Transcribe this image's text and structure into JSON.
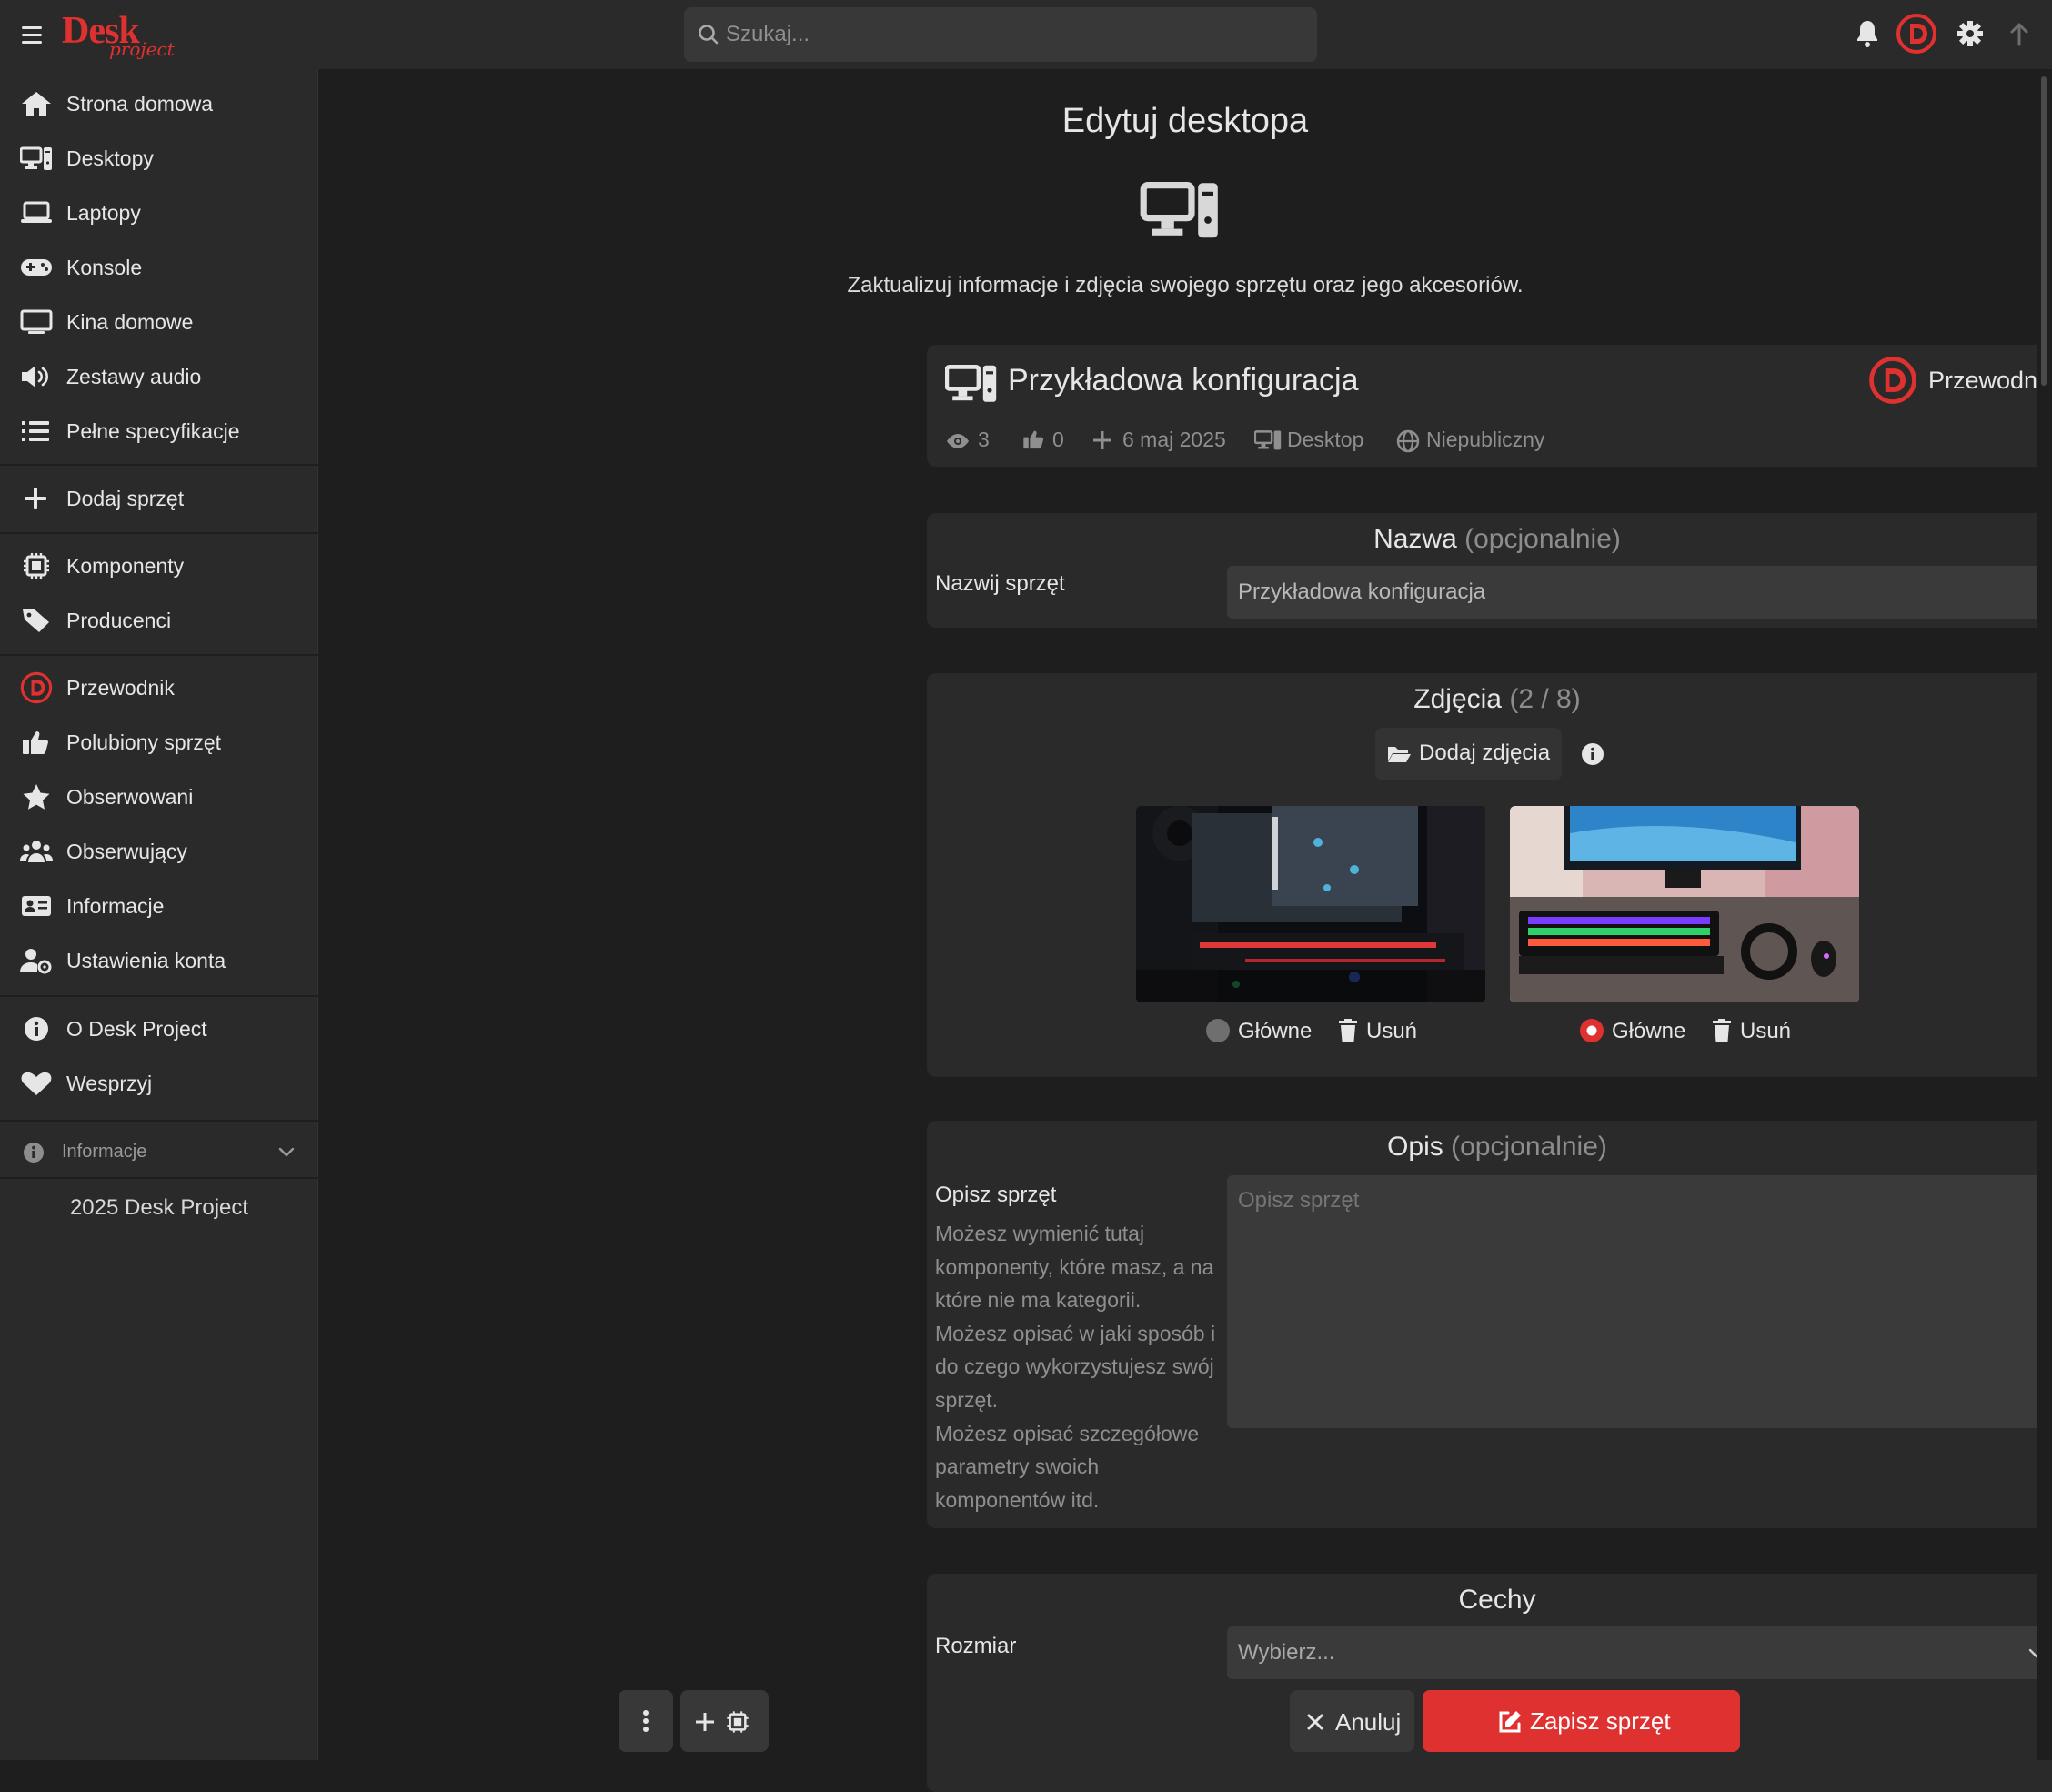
{
  "app": {
    "logo_main": "Desk",
    "logo_sub": "project"
  },
  "search": {
    "placeholder": "Szukaj..."
  },
  "colors": {
    "accent": "#e03131",
    "background": "#1e1e1e",
    "panel": "#2a2a2a",
    "input": "#3a3a3a"
  },
  "sidebar": {
    "items": [
      {
        "label": "Strona domowa",
        "icon": "home-icon"
      },
      {
        "label": "Desktopy",
        "icon": "desktop-icon"
      },
      {
        "label": "Laptopy",
        "icon": "laptop-icon"
      },
      {
        "label": "Konsole",
        "icon": "gamepad-icon"
      },
      {
        "label": "Kina domowe",
        "icon": "tv-icon"
      },
      {
        "label": "Zestawy audio",
        "icon": "speaker-icon"
      },
      {
        "label": "Pełne specyfikacje",
        "icon": "list-icon"
      },
      {
        "label": "Dodaj sprzęt",
        "icon": "plus-icon"
      },
      {
        "label": "Komponenty",
        "icon": "chip-icon"
      },
      {
        "label": "Producenci",
        "icon": "tag-icon"
      },
      {
        "label": "Przewodnik",
        "icon": "user-avatar-icon"
      },
      {
        "label": "Polubiony sprzęt",
        "icon": "thumbs-up-icon"
      },
      {
        "label": "Obserwowani",
        "icon": "star-icon"
      },
      {
        "label": "Obserwujący",
        "icon": "users-icon"
      },
      {
        "label": "Informacje",
        "icon": "id-card-icon"
      },
      {
        "label": "Ustawienia konta",
        "icon": "user-gear-icon"
      },
      {
        "label": "O Desk Project",
        "icon": "info-icon"
      },
      {
        "label": "Wesprzyj",
        "icon": "heart-icon"
      }
    ],
    "info_toggle": "Informacje",
    "footer": "2025 Desk Project"
  },
  "page": {
    "title": "Edytuj desktopa",
    "subtitle": "Zaktualizuj informacje i zdjęcia swojego sprzętu oraz jego akcesoriów."
  },
  "summary": {
    "name": "Przykładowa konfiguracja",
    "owner": "Przewodnik",
    "views": "3",
    "likes": "0",
    "date": "6 maj 2025",
    "type": "Desktop",
    "visibility": "Niepubliczny"
  },
  "name_section": {
    "title": "Nazwa",
    "optional": "(opcjonalnie)",
    "label": "Nazwij sprzęt",
    "value": "Przykładowa konfiguracja"
  },
  "photos": {
    "title": "Zdjęcia",
    "count": "(2 / 8)",
    "add_label": "Dodaj zdjęcia",
    "items": [
      {
        "main_label": "Główne",
        "delete_label": "Usuń",
        "is_main": false
      },
      {
        "main_label": "Główne",
        "delete_label": "Usuń",
        "is_main": true
      }
    ]
  },
  "description": {
    "title": "Opis",
    "optional": "(opcjonalnie)",
    "label": "Opisz sprzęt",
    "placeholder": "Opisz sprzęt",
    "help": [
      "Możesz wymienić tutaj komponenty, które masz, a na które nie ma kategorii.",
      "Możesz opisać w jaki sposób i do czego wykorzystujesz swój sprzęt.",
      "Możesz opisać szczegółowe parametry swoich komponentów itd."
    ]
  },
  "features": {
    "title": "Cechy",
    "size_label": "Rozmiar",
    "size_value": "Wybierz..."
  },
  "actions": {
    "cancel_label": "Anuluj",
    "save_label": "Zapisz sprzęt"
  }
}
